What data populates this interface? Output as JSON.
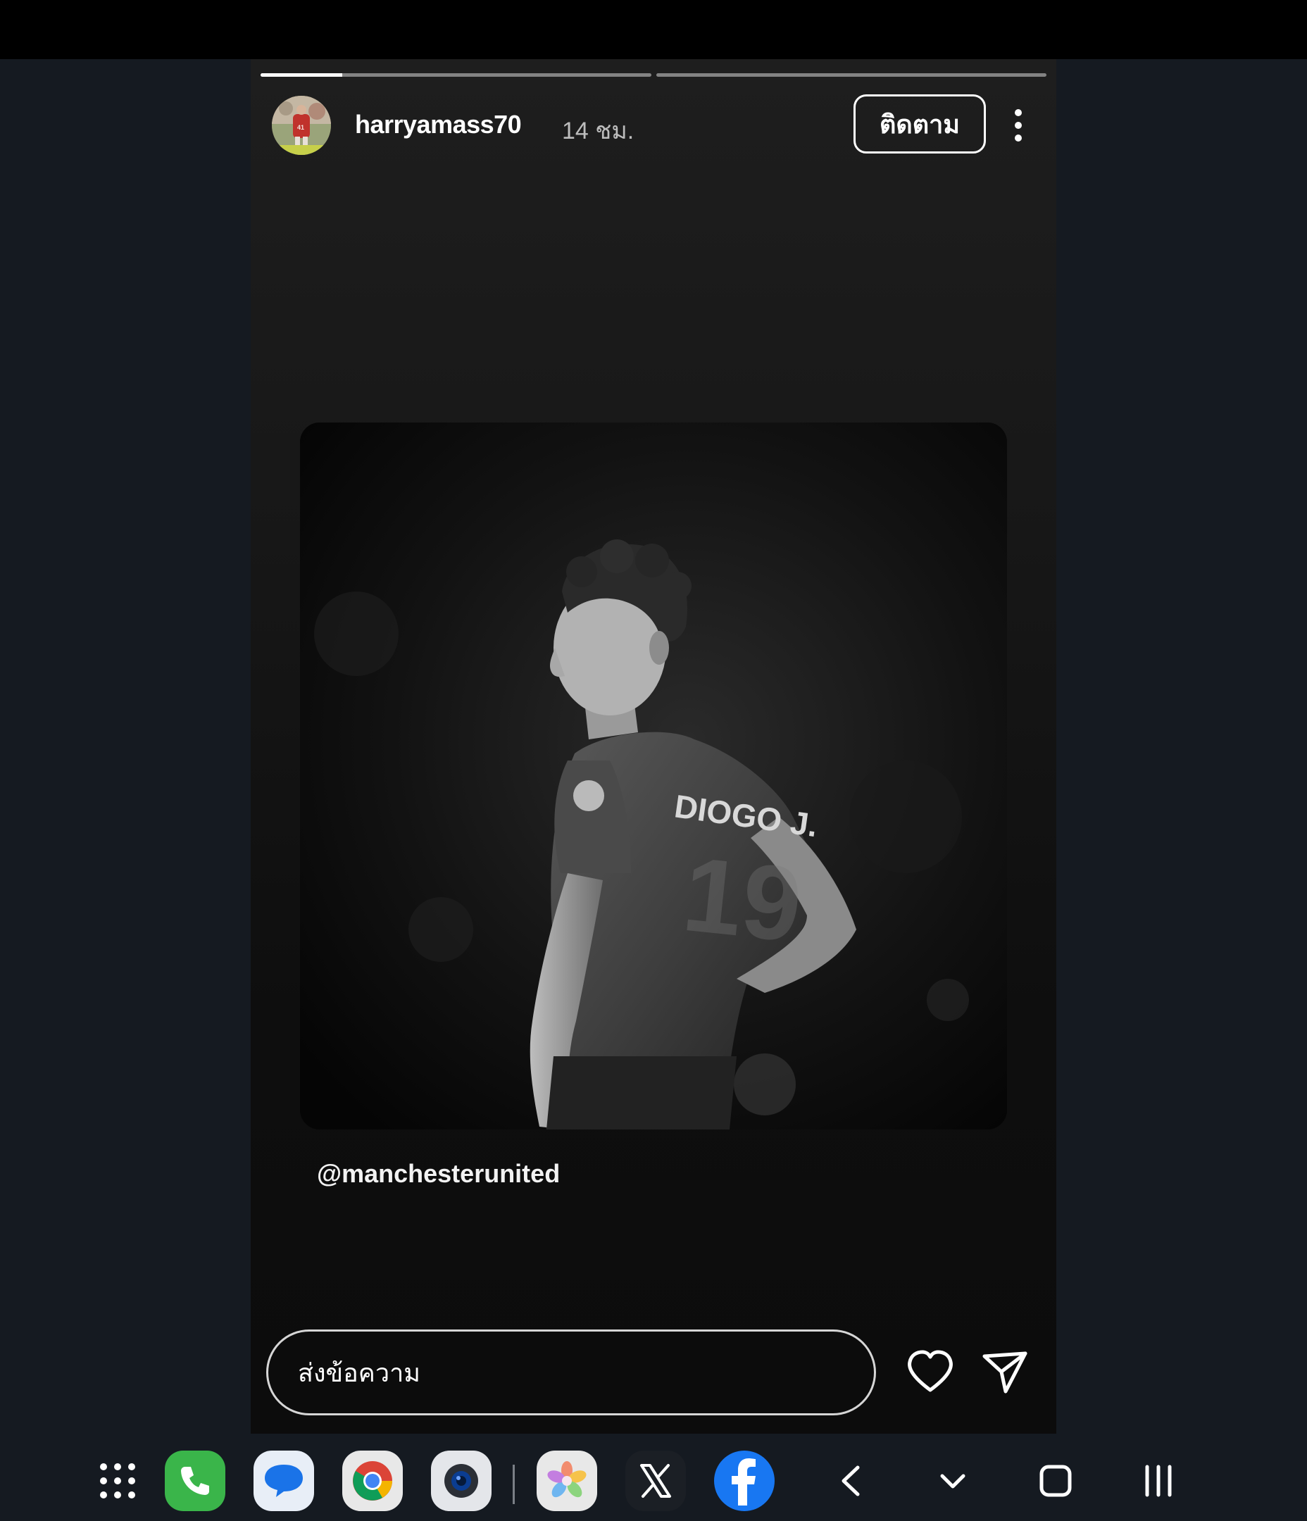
{
  "story": {
    "progress_segments": [
      0.21,
      0.0
    ],
    "username": "harryamass70",
    "timestamp": "14 ชม.",
    "follow_label": "ติดตาม",
    "mention": "@manchesterunited",
    "jersey_name": "DIOGO J.",
    "reply_placeholder": "ส่งข้อความ"
  },
  "taskbar": {
    "apps": [
      {
        "name": "apps-grid-icon"
      },
      {
        "name": "phone-app-icon",
        "color": "#3ab54a"
      },
      {
        "name": "messages-app-icon",
        "color": "#1a73e8"
      },
      {
        "name": "chrome-app-icon"
      },
      {
        "name": "camera-app-icon"
      },
      {
        "name": "photos-app-icon"
      },
      {
        "name": "x-app-icon"
      },
      {
        "name": "facebook-app-icon",
        "color": "#1877f2"
      }
    ],
    "nav": [
      "back-icon",
      "hide-keyboard-icon",
      "home-icon",
      "recents-icon"
    ]
  }
}
